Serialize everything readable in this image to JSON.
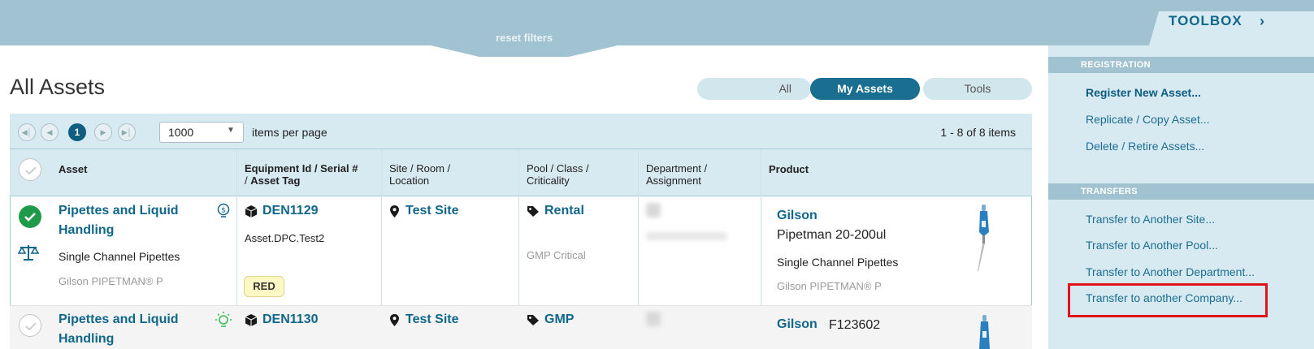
{
  "filters": {
    "reset_label": "reset filters"
  },
  "toolbox": {
    "title": "TOOLBOX",
    "sections": [
      {
        "label": "REGISTRATION",
        "items": [
          "Register New Asset...",
          "Replicate / Copy Asset...",
          "Delete / Retire Assets..."
        ]
      },
      {
        "label": "TRANSFERS",
        "items": [
          "Transfer to Another Site...",
          "Transfer to Another Pool...",
          "Transfer to Another Department...",
          "Transfer to another Company..."
        ]
      }
    ]
  },
  "page": {
    "title": "All Assets"
  },
  "view_toggle": {
    "options": [
      "All",
      "My Assets",
      "Tools"
    ],
    "selected": "My Assets"
  },
  "pager": {
    "current_page": "1",
    "items_per_page": "1000",
    "items_per_page_label": "items per page",
    "count_text": "1 - 8 of 8 items"
  },
  "columns": {
    "asset": "Asset",
    "equipment_a": "Equipment Id",
    "equipment_b": " / Serial #",
    "equipment_c": "/ ",
    "equipment_d": "Asset Tag",
    "site_a": "Site / Room /",
    "site_b": "Location",
    "pool_a": "Pool / Class /",
    "pool_b": "Criticality",
    "dept_a": "Department /",
    "dept_b": "Assignment",
    "product": "Product"
  },
  "rows": [
    {
      "category": "Pipettes and Liquid",
      "category_cont": "Handling",
      "type": "Single Channel Pipettes",
      "model": "Gilson PIPETMAN® P",
      "equipment_id": "DEN1129",
      "serial": "Asset.DPC.Test2",
      "tag": "RED",
      "site": "Test Site",
      "pool": "Rental",
      "criticality": "GMP Critical",
      "manufacturer": "Gilson",
      "product_name": "Pipetman 20-200ul",
      "product_type": "Single Channel Pipettes",
      "product_model": "Gilson PIPETMAN® P"
    },
    {
      "category": "Pipettes and Liquid",
      "category_cont": "Handling",
      "equipment_id": "DEN1130",
      "site": "Test Site",
      "pool": "GMP",
      "manufacturer": "Gilson",
      "product_code": "F123602"
    }
  ],
  "colors": {
    "accent": "#11678a",
    "band": "#a1c3d1",
    "panel": "#d7e9f1",
    "success": "#1f9a48",
    "highlight": "#e1141a"
  }
}
